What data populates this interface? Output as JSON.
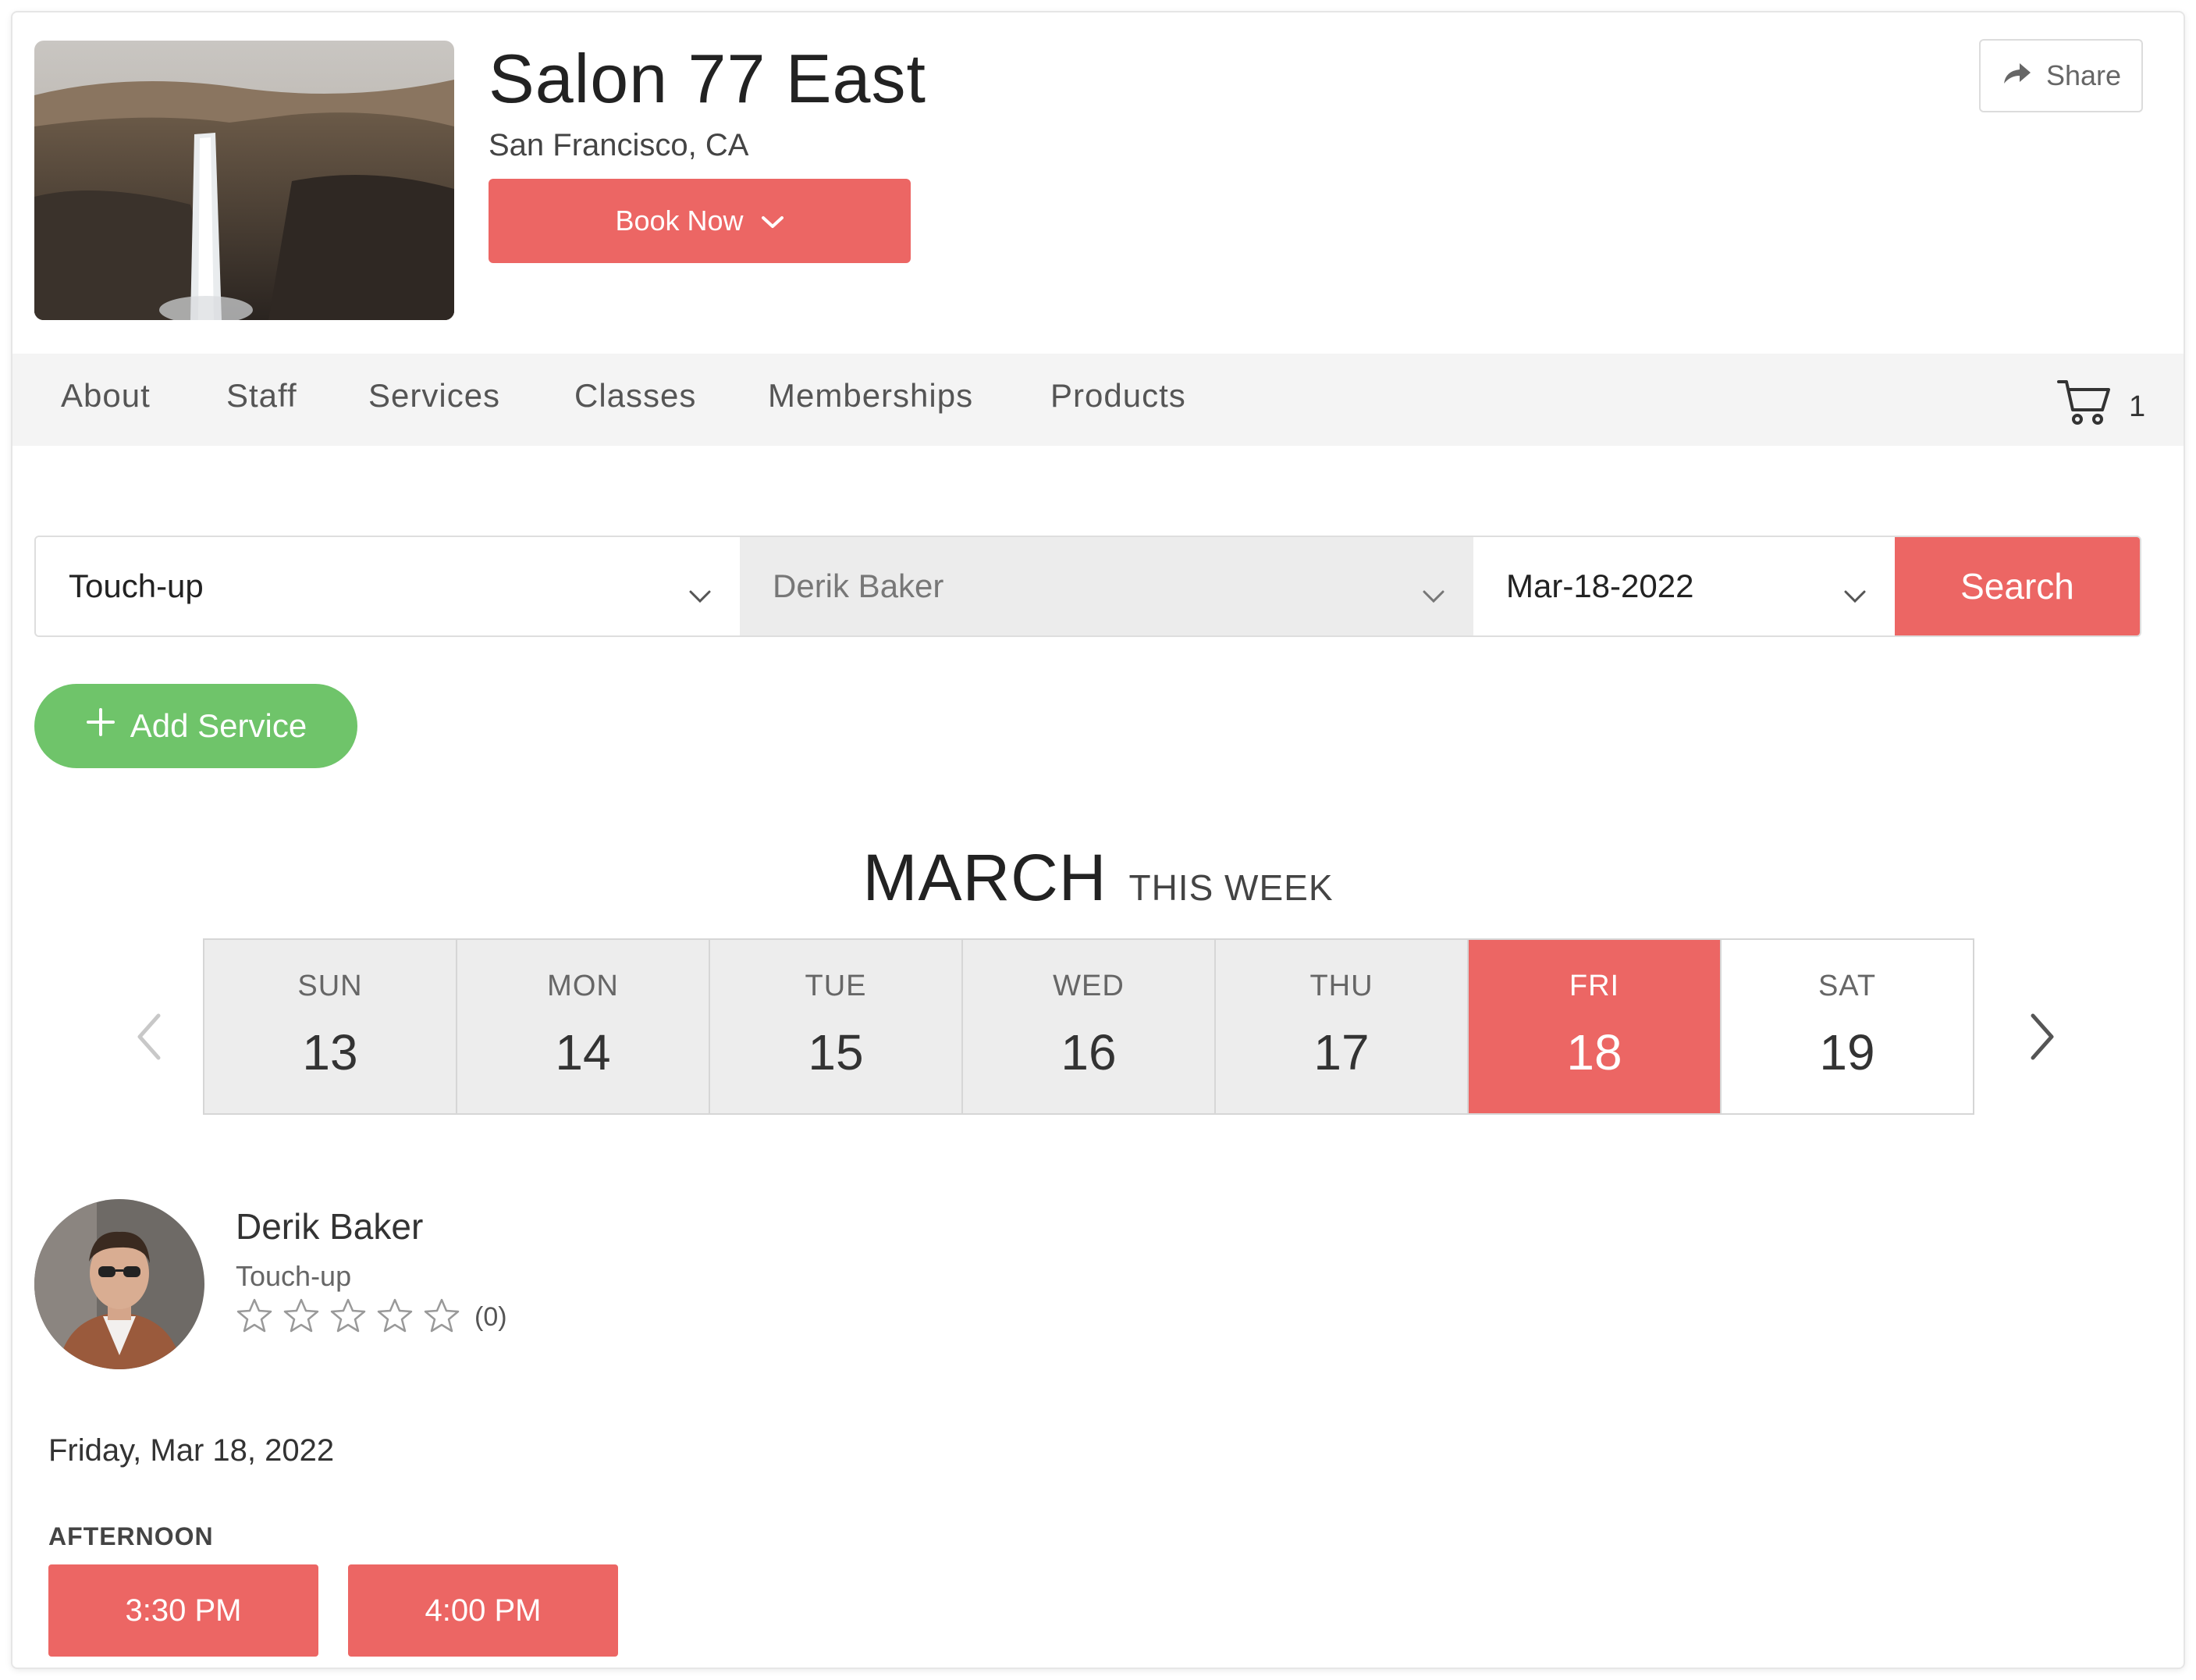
{
  "business": {
    "name": "Salon 77 East",
    "location": "San Francisco, CA",
    "book_label": "Book Now",
    "share_label": "Share"
  },
  "nav": {
    "items": [
      "About",
      "Staff",
      "Services",
      "Classes",
      "Memberships",
      "Products"
    ],
    "cart_count": "1"
  },
  "search": {
    "service_value": "Touch-up",
    "staff_value": "Derik Baker",
    "date_value": "Mar-18-2022",
    "search_label": "Search"
  },
  "add_service_label": "Add Service",
  "calendar": {
    "month": "MARCH",
    "week_label": "THIS WEEK",
    "days": [
      {
        "name": "SUN",
        "num": "13"
      },
      {
        "name": "MON",
        "num": "14"
      },
      {
        "name": "TUE",
        "num": "15"
      },
      {
        "name": "WED",
        "num": "16"
      },
      {
        "name": "THU",
        "num": "17"
      },
      {
        "name": "FRI",
        "num": "18"
      },
      {
        "name": "SAT",
        "num": "19"
      }
    ],
    "selected_day": "FRI"
  },
  "staff": {
    "name": "Derik Baker",
    "service": "Touch-up",
    "rating": 0,
    "review_count": "(0)"
  },
  "availability": {
    "date": "Friday, Mar 18, 2022",
    "period": "AFTERNOON",
    "slots": [
      "3:30 PM",
      "4:00 PM"
    ]
  },
  "colors": {
    "accent": "#ec6664",
    "add_button": "#6fc46a",
    "nav_bg": "#f4f4f4"
  }
}
